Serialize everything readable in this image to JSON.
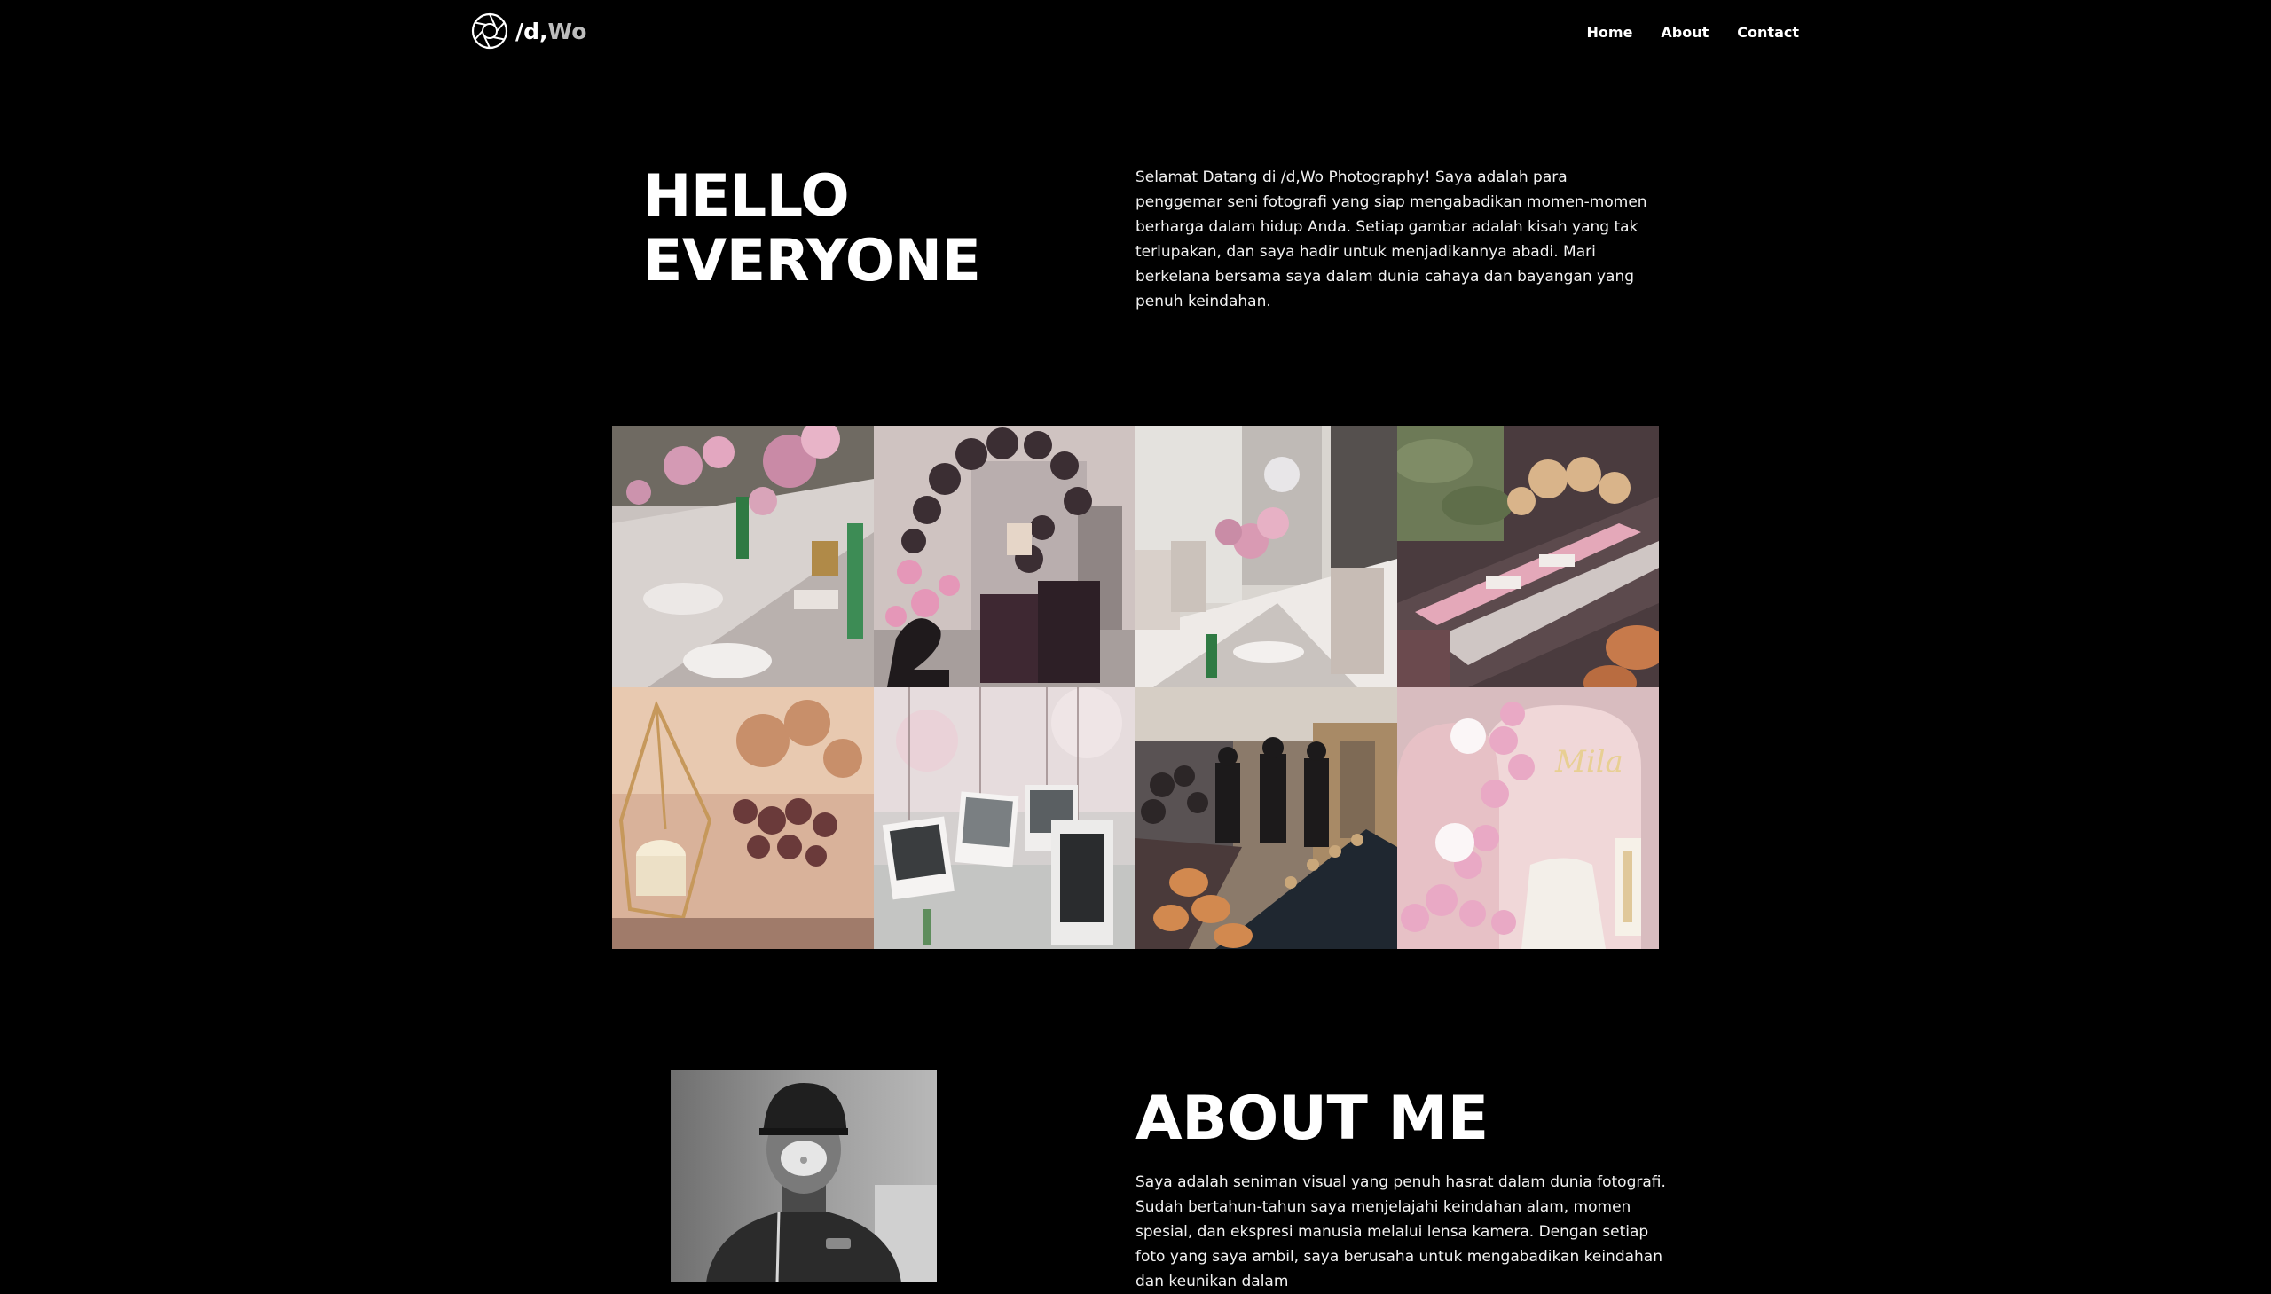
{
  "brand": {
    "logo_icon": "aperture-icon",
    "name_prefix": "/d,",
    "name_suffix": "Wo"
  },
  "nav": {
    "items": [
      {
        "label": "Home"
      },
      {
        "label": "About"
      },
      {
        "label": "Contact"
      }
    ]
  },
  "hero": {
    "title_line1": "HELLO",
    "title_line2": "EVERYONE",
    "intro": "Selamat Datang di /d,Wo Photography! Saya adalah para penggemar seni fotografi yang siap mengabadikan momen-momen berharga dalam hidup Anda. Setiap gambar adalah kisah yang tak terlupakan, dan saya hadir untuk menjadikannya abadi. Mari berkelana bersama saya dalam dunia cahaya dan bayangan yang penuh keindahan."
  },
  "gallery": {
    "photos": [
      {
        "subject": "table-setting-flowers-photo"
      },
      {
        "subject": "balloon-arch-number-two-photo"
      },
      {
        "subject": "dining-room-table-photo"
      },
      {
        "subject": "long-table-dried-flowers-photo"
      },
      {
        "subject": "glass-terrarium-candle-photo"
      },
      {
        "subject": "hanging-polaroid-photos-photo"
      },
      {
        "subject": "guests-banquet-hall-photo"
      },
      {
        "subject": "pink-balloon-backdrop-photo",
        "visible_text": "Mila"
      }
    ]
  },
  "about": {
    "title": "ABOUT ME",
    "text": "Saya adalah seniman visual yang penuh hasrat dalam dunia fotografi. Sudah bertahun-tahun saya menjelajahi keindahan alam, momen spesial, dan ekspresi manusia melalui lensa kamera. Dengan setiap foto yang saya ambil, saya berusaha untuk mengabadikan keindahan dan keunikan dalam"
  },
  "colors": {
    "background": "#000000",
    "text": "#ffffff",
    "brand_dim": "#bdbdbd"
  }
}
